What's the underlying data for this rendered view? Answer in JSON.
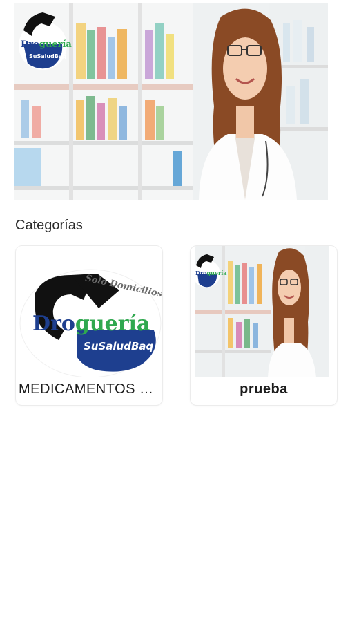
{
  "banner": {
    "logo_text": "Droguería",
    "logo_sub": "SuSaludBaq",
    "logo_tag": "Solo Domicilios"
  },
  "categories": {
    "title": "Categorías",
    "items": [
      {
        "label": "MEDICAMENTOS G..."
      },
      {
        "label": "prueba"
      }
    ]
  },
  "colors": {
    "brand_blue": "#1e3f8f",
    "brand_green": "#2fa84f",
    "coat": "#ffffff"
  }
}
